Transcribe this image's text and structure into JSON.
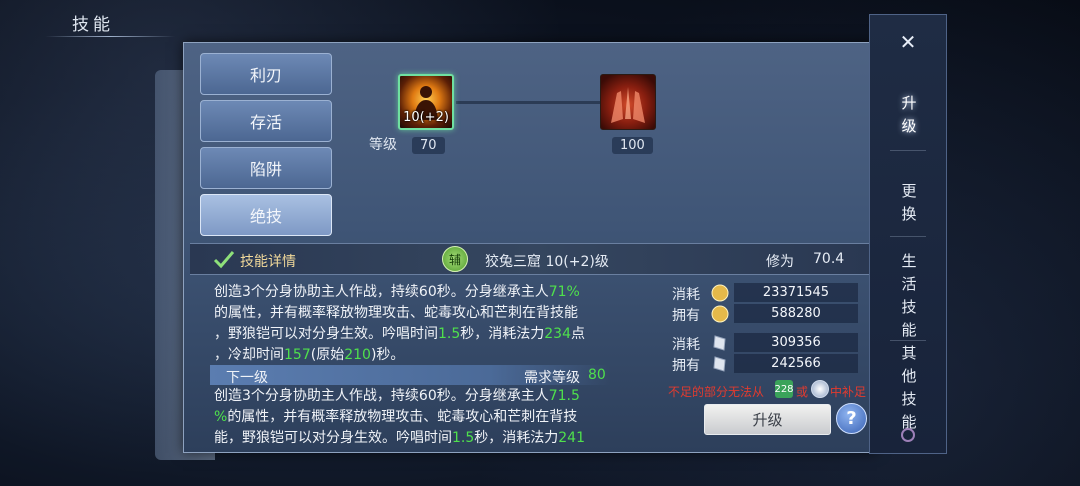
{
  "page": {
    "title": "技能"
  },
  "categories": [
    {
      "label": "利刃",
      "active": false
    },
    {
      "label": "存活",
      "active": false
    },
    {
      "label": "陷阱",
      "active": false
    },
    {
      "label": "绝技",
      "active": true
    }
  ],
  "skill_tree": {
    "level_label": "等级",
    "nodes": [
      {
        "icon": "figure-flame-skill-icon",
        "level_text": "10(+2)",
        "required_level": "70",
        "selected": true
      },
      {
        "icon": "hands-flame-skill-icon",
        "level_text": "",
        "required_level": "100",
        "selected": false
      }
    ]
  },
  "details": {
    "header_label": "技能详情",
    "type_badge": "辅",
    "skill_name": "狡兔三窟 10(+2)级",
    "cultivation_label": "修为",
    "cultivation_value": "70.4"
  },
  "description": {
    "current": [
      [
        {
          "t": "创造3个分身协助主人作战，持续60秒。分身继承主人"
        },
        {
          "t": "71%",
          "hl": true
        }
      ],
      [
        {
          "t": "的属性，并有概率释放物理攻击、蛇毒攻心和芒刺在背技能"
        }
      ],
      [
        {
          "t": "，野狼铠可以对分身生效。吟唱时间"
        },
        {
          "t": "1.5",
          "hl": true
        },
        {
          "t": "秒，消耗法力"
        },
        {
          "t": "234",
          "hl": true
        },
        {
          "t": "点"
        }
      ],
      [
        {
          "t": "，冷却时间"
        },
        {
          "t": "157",
          "hl": true
        },
        {
          "t": "(原始"
        },
        {
          "t": "210",
          "hl": true
        },
        {
          "t": ")秒。"
        }
      ]
    ],
    "next_label": "下一级",
    "required_label": "需求等级",
    "required_value": "80",
    "next": [
      [
        {
          "t": "创造3个分身协助主人作战，持续60秒。分身继承主人"
        },
        {
          "t": "71.5",
          "hl": true
        }
      ],
      [
        {
          "t": "%",
          "hl": true
        },
        {
          "t": "的属性，并有概率释放物理攻击、蛇毒攻心和芒刺在背技"
        }
      ],
      [
        {
          "t": "能，野狼铠可以对分身生效。吟唱时间"
        },
        {
          "t": "1.5",
          "hl": true
        },
        {
          "t": "秒，消耗法力"
        },
        {
          "t": "241",
          "hl": true
        }
      ]
    ]
  },
  "costs": [
    {
      "label": "消耗",
      "icon": "experience-coin-icon",
      "value": "23371545"
    },
    {
      "label": "拥有",
      "icon": "experience-coin-icon",
      "value": "588280"
    },
    {
      "label": "消耗",
      "icon": "skill-book-icon",
      "value": "309356"
    },
    {
      "label": "拥有",
      "icon": "skill-book-icon",
      "value": "242566"
    }
  ],
  "warning": {
    "text_a": "不足的部分无法从",
    "icon_a": "228",
    "text_b": "或",
    "text_c": "中补足"
  },
  "upgrade_button": "升级",
  "help_button": "?",
  "side_tabs": [
    {
      "label": "升级",
      "active": true
    },
    {
      "label": "更换",
      "active": false
    },
    {
      "label": "生活技能",
      "active": false
    },
    {
      "label": "其他技能",
      "active": false
    }
  ],
  "colors": {
    "highlight_green": "#4fe04c",
    "warning_red": "#e23b2f",
    "panel_blue": "#3f5576"
  }
}
